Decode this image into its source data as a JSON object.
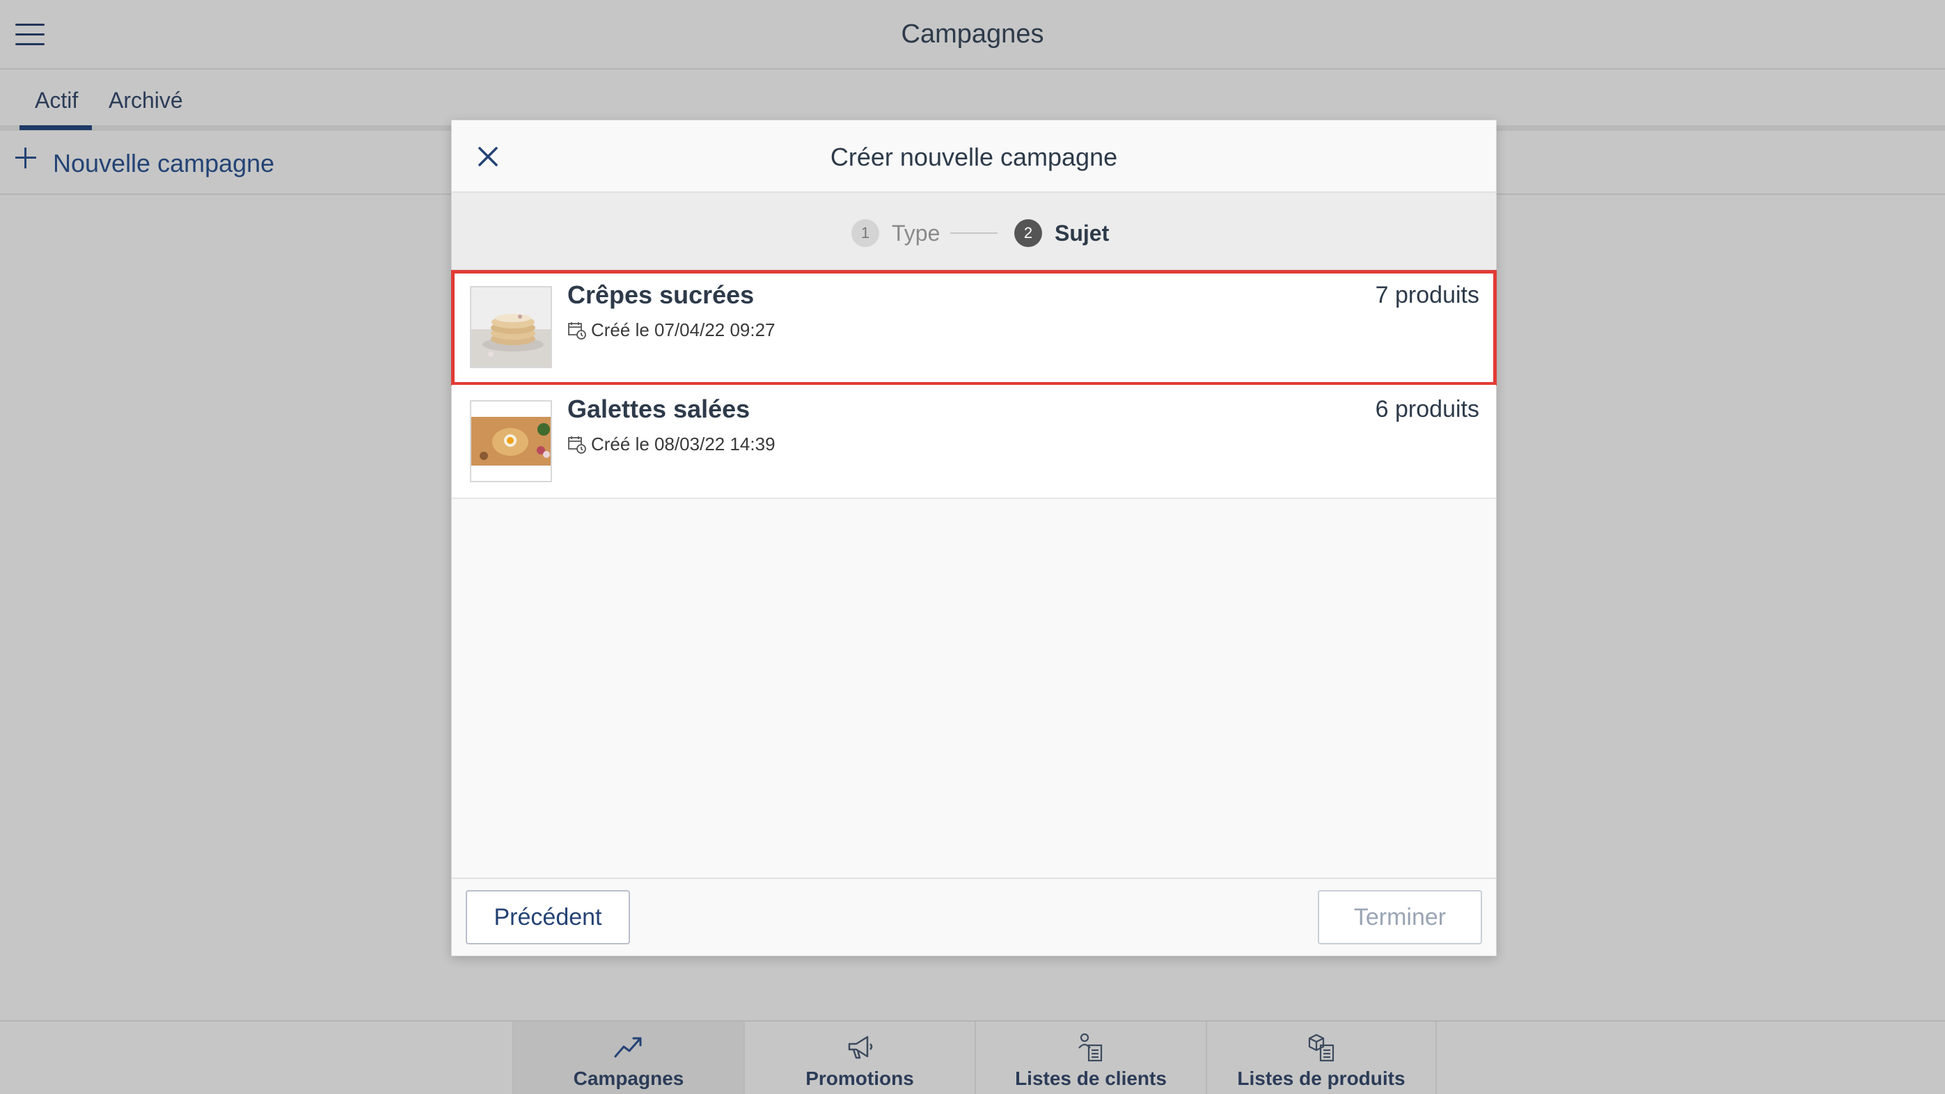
{
  "header": {
    "title": "Campagnes",
    "menu_icon": "hamburger-menu-icon"
  },
  "tabs": [
    {
      "label": "Actif",
      "active": true
    },
    {
      "label": "Archivé",
      "active": false
    }
  ],
  "toolbar": {
    "new_campaign_label": "Nouvelle campagne"
  },
  "modal": {
    "title": "Créer nouvelle campagne",
    "steps": [
      {
        "number": "1",
        "label": "Type",
        "state": "done"
      },
      {
        "number": "2",
        "label": "Sujet",
        "state": "current"
      }
    ],
    "items": [
      {
        "title": "Crêpes sucrées",
        "meta": "Créé le 07/04/22 09:27",
        "count": "7 produits",
        "selected": true
      },
      {
        "title": "Galettes salées",
        "meta": "Créé le 08/03/22 14:39",
        "count": "6 produits",
        "selected": false
      }
    ],
    "buttons": {
      "previous": "Précédent",
      "finish": "Terminer"
    }
  },
  "bottom_nav": [
    {
      "label": "Campagnes",
      "icon": "trend-up-icon",
      "active": true
    },
    {
      "label": "Promotions",
      "icon": "megaphone-icon",
      "active": false
    },
    {
      "label": "Listes de clients",
      "icon": "customer-list-icon",
      "active": false
    },
    {
      "label": "Listes de produits",
      "icon": "product-list-icon",
      "active": false
    }
  ],
  "colors": {
    "accent": "#1f3a66",
    "selection": "#e23b35",
    "backdrop": "#c6c6c6"
  }
}
